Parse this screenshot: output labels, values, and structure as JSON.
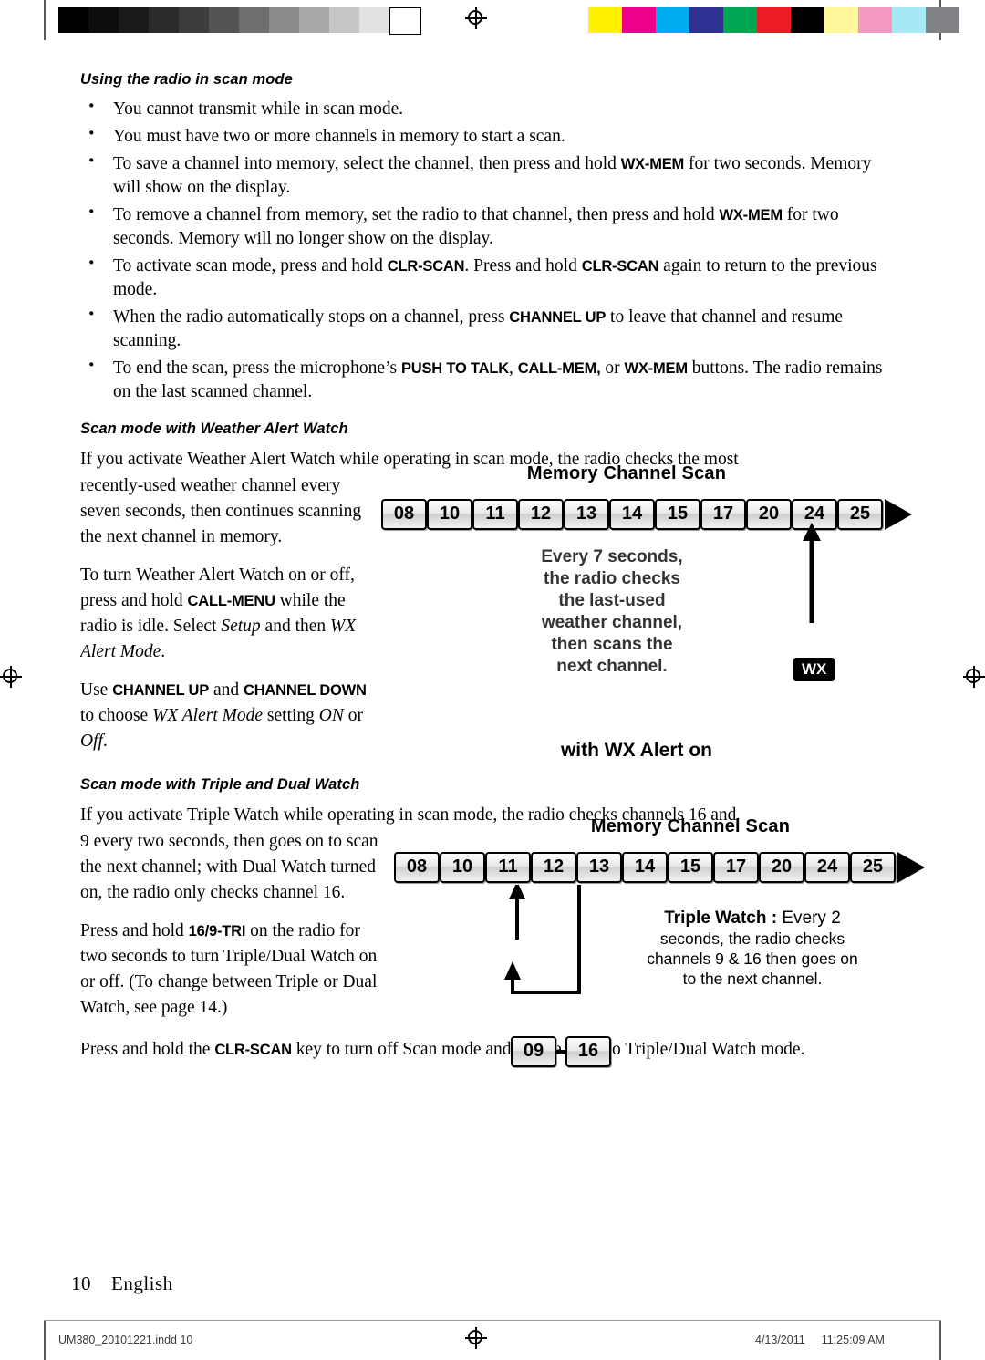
{
  "page": {
    "number": "10",
    "language_label": "English"
  },
  "print_marks": {
    "grayscale_swatches": [
      "#000000",
      "#0d0d0d",
      "#1a1a1a",
      "#2b2b2b",
      "#3d3d3d",
      "#545454",
      "#6e6e6e",
      "#8b8b8b",
      "#a8a8a8",
      "#c6c6c6",
      "#e2e2e2",
      "#ffffff"
    ],
    "color_swatches": [
      "#fff200",
      "#ec008c",
      "#00aeef",
      "#2e3192",
      "#00a651",
      "#ed1c24",
      "#000000",
      "#fff799",
      "#f49ac1",
      "#a7e8f7",
      "#808285"
    ],
    "registration_icon": "registration-target-icon"
  },
  "sections": [
    {
      "heading": "Using the radio in scan mode",
      "bullets": [
        [
          {
            "t": "You cannot transmit while in scan mode."
          }
        ],
        [
          {
            "t": "You must have two or more channels in memory to start a scan."
          }
        ],
        [
          {
            "t": "To save a channel into memory, select the channel, then press and hold "
          },
          {
            "k": "WX-MEM"
          },
          {
            "t": " for two seconds. Memory will show on the display."
          }
        ],
        [
          {
            "t": "To remove a channel from memory, set the radio to that channel, then press and hold "
          },
          {
            "k": "WX-MEM"
          },
          {
            "t": " for two seconds. Memory will no longer show on the display."
          }
        ],
        [
          {
            "t": "To activate scan mode, press and hold "
          },
          {
            "k": "CLR-SCAN"
          },
          {
            "t": ". Press and hold "
          },
          {
            "k": "CLR-SCAN"
          },
          {
            "t": " again to return to the previous mode."
          }
        ],
        [
          {
            "t": "When the radio automatically stops on a channel, press "
          },
          {
            "k": "CHANNEL UP"
          },
          {
            "t": " to leave that channel and resume scanning."
          }
        ],
        [
          {
            "t": "To end the scan, press the microphone’s "
          },
          {
            "k": "PUSH TO TALK"
          },
          {
            "t": ", "
          },
          {
            "k": "CALL-MEM,"
          },
          {
            "t": " or "
          },
          {
            "k": "WX-MEM"
          },
          {
            "t": " buttons. The radio remains on the last scanned channel."
          }
        ]
      ]
    }
  ],
  "wx_section": {
    "heading": "Scan mode with Weather Alert Watch",
    "intro": "If you activate Weather Alert Watch while operating in scan mode, the radio checks the most",
    "para1": "recently-used weather channel every seven seconds, then continues scanning the next channel in memory.",
    "para2_a": "To turn Weather Alert Watch on or off, press and hold ",
    "para2_key": "CALL-MENU",
    "para2_b": " while the radio is idle. Select ",
    "para2_i1": "Setup",
    "para2_c": " and then ",
    "para2_i2": "WX Alert Mode",
    "para2_d": ".",
    "para3_a": "Use ",
    "para3_key1": "CHANNEL UP",
    "para3_b": " and ",
    "para3_key2": "CHANNEL DOWN",
    "para3_c": " to choose ",
    "para3_i1": "WX Alert  Mode",
    "para3_d": " setting ",
    "para3_i2": "ON",
    "para3_e": " or ",
    "para3_i3": "Off",
    "para3_f": "."
  },
  "figure_wx": {
    "title": "Memory Channel Scan",
    "channels": [
      "08",
      "10",
      "11",
      "12",
      "13",
      "14",
      "15",
      "17",
      "20",
      "24",
      "25"
    ],
    "caption_lines": [
      "Every 7 seconds,",
      "the radio checks",
      "the last-used",
      "weather channel,",
      "then scans the",
      "next channel."
    ],
    "badge": "WX",
    "footer": "with WX Alert on"
  },
  "triple_section": {
    "heading": "Scan mode with Triple and Dual Watch",
    "intro": "If you activate Triple Watch while operating in scan mode, the radio checks channels 16 and",
    "para1": "9 every two seconds, then goes on to scan the next channel; with Dual Watch turned on, the radio only checks channel 16.",
    "para2_a": "Press and hold ",
    "para2_key": "16/9-TRI",
    "para2_b": " on the radio for two seconds to turn Triple/Dual Watch on or off. (To change between Triple or Dual Watch, see page 14.)",
    "para3_a": "Press and hold the ",
    "para3_key": "CLR-SCAN",
    "para3_b": " key to turn off Scan mode and set the radio to Triple/Dual Watch mode."
  },
  "figure_triple": {
    "title": "Memory Channel Scan",
    "channels_group1": [
      "08",
      "10",
      "11",
      "12"
    ],
    "channels_group2": [
      "13",
      "14",
      "15",
      "17",
      "20",
      "24",
      "25"
    ],
    "branch_channels": [
      "09",
      "16"
    ],
    "caption_title": "Triple Watch :",
    "caption_lead": " Every 2",
    "caption_lines": [
      "seconds, the radio checks",
      "channels 9 & 16 then goes on",
      "to the next channel."
    ]
  },
  "footer_meta": {
    "file": "UM380_20101221.indd   10",
    "date": "4/13/2011",
    "time": "11:25:09 AM"
  }
}
